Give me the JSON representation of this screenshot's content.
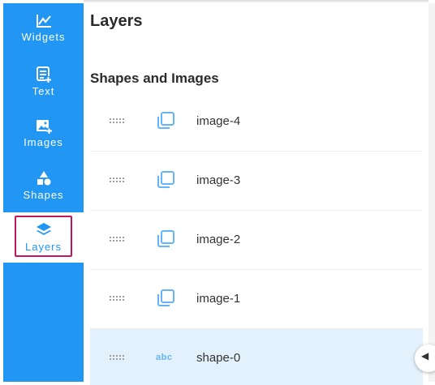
{
  "sidebar": {
    "items": [
      {
        "label": "Widgets",
        "icon": "chart-line-icon"
      },
      {
        "label": "Text",
        "icon": "text-icon"
      },
      {
        "label": "Images",
        "icon": "image-add-icon"
      },
      {
        "label": "Shapes",
        "icon": "shapes-icon"
      },
      {
        "label": "Layers",
        "icon": "layers-icon",
        "active": true
      }
    ]
  },
  "panel": {
    "title": "Layers",
    "section_title": "Shapes and Images",
    "layers": [
      {
        "name": "image-4",
        "type": "image"
      },
      {
        "name": "image-3",
        "type": "image"
      },
      {
        "name": "image-2",
        "type": "image"
      },
      {
        "name": "image-1",
        "type": "image"
      },
      {
        "name": "shape-0",
        "type": "text",
        "type_label": "abc",
        "selected": true
      }
    ]
  },
  "colors": {
    "sidebar": "#2196f3",
    "active_outline": "#c2185b",
    "selected_row": "#e3f1fc",
    "icon_light": "#64b5f6"
  }
}
